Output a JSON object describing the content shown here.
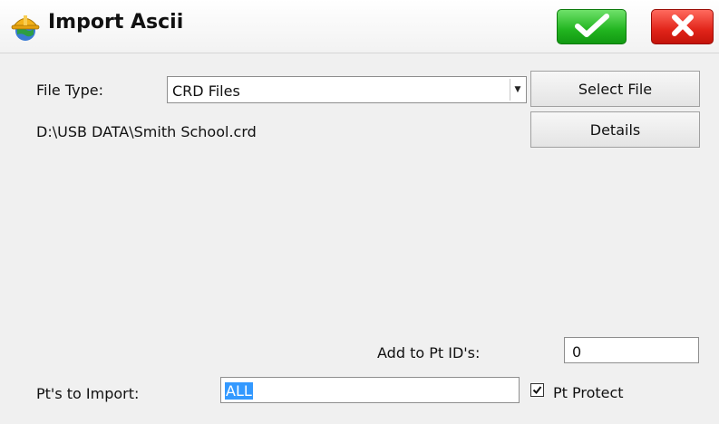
{
  "window": {
    "title": "Import Ascii",
    "app_icon": "hardhat-globe-icon",
    "ok_icon": "checkmark-icon",
    "cancel_icon": "close-x-icon",
    "colors": {
      "ok": "#21b41f",
      "cancel": "#e12419",
      "selection": "#3399ff"
    }
  },
  "form": {
    "file_type_label": "File Type:",
    "file_type_value": "CRD Files",
    "select_file_label": "Select File",
    "details_label": "Details",
    "file_path": "D:\\USB DATA\\Smith School.crd",
    "add_to_pt_ids_label": "Add to Pt ID's:",
    "add_to_pt_ids_value": "0",
    "pts_to_import_label": "Pt's to Import:",
    "pts_to_import_value": "ALL",
    "pt_protect_label": "Pt Protect",
    "pt_protect_checked": true
  }
}
